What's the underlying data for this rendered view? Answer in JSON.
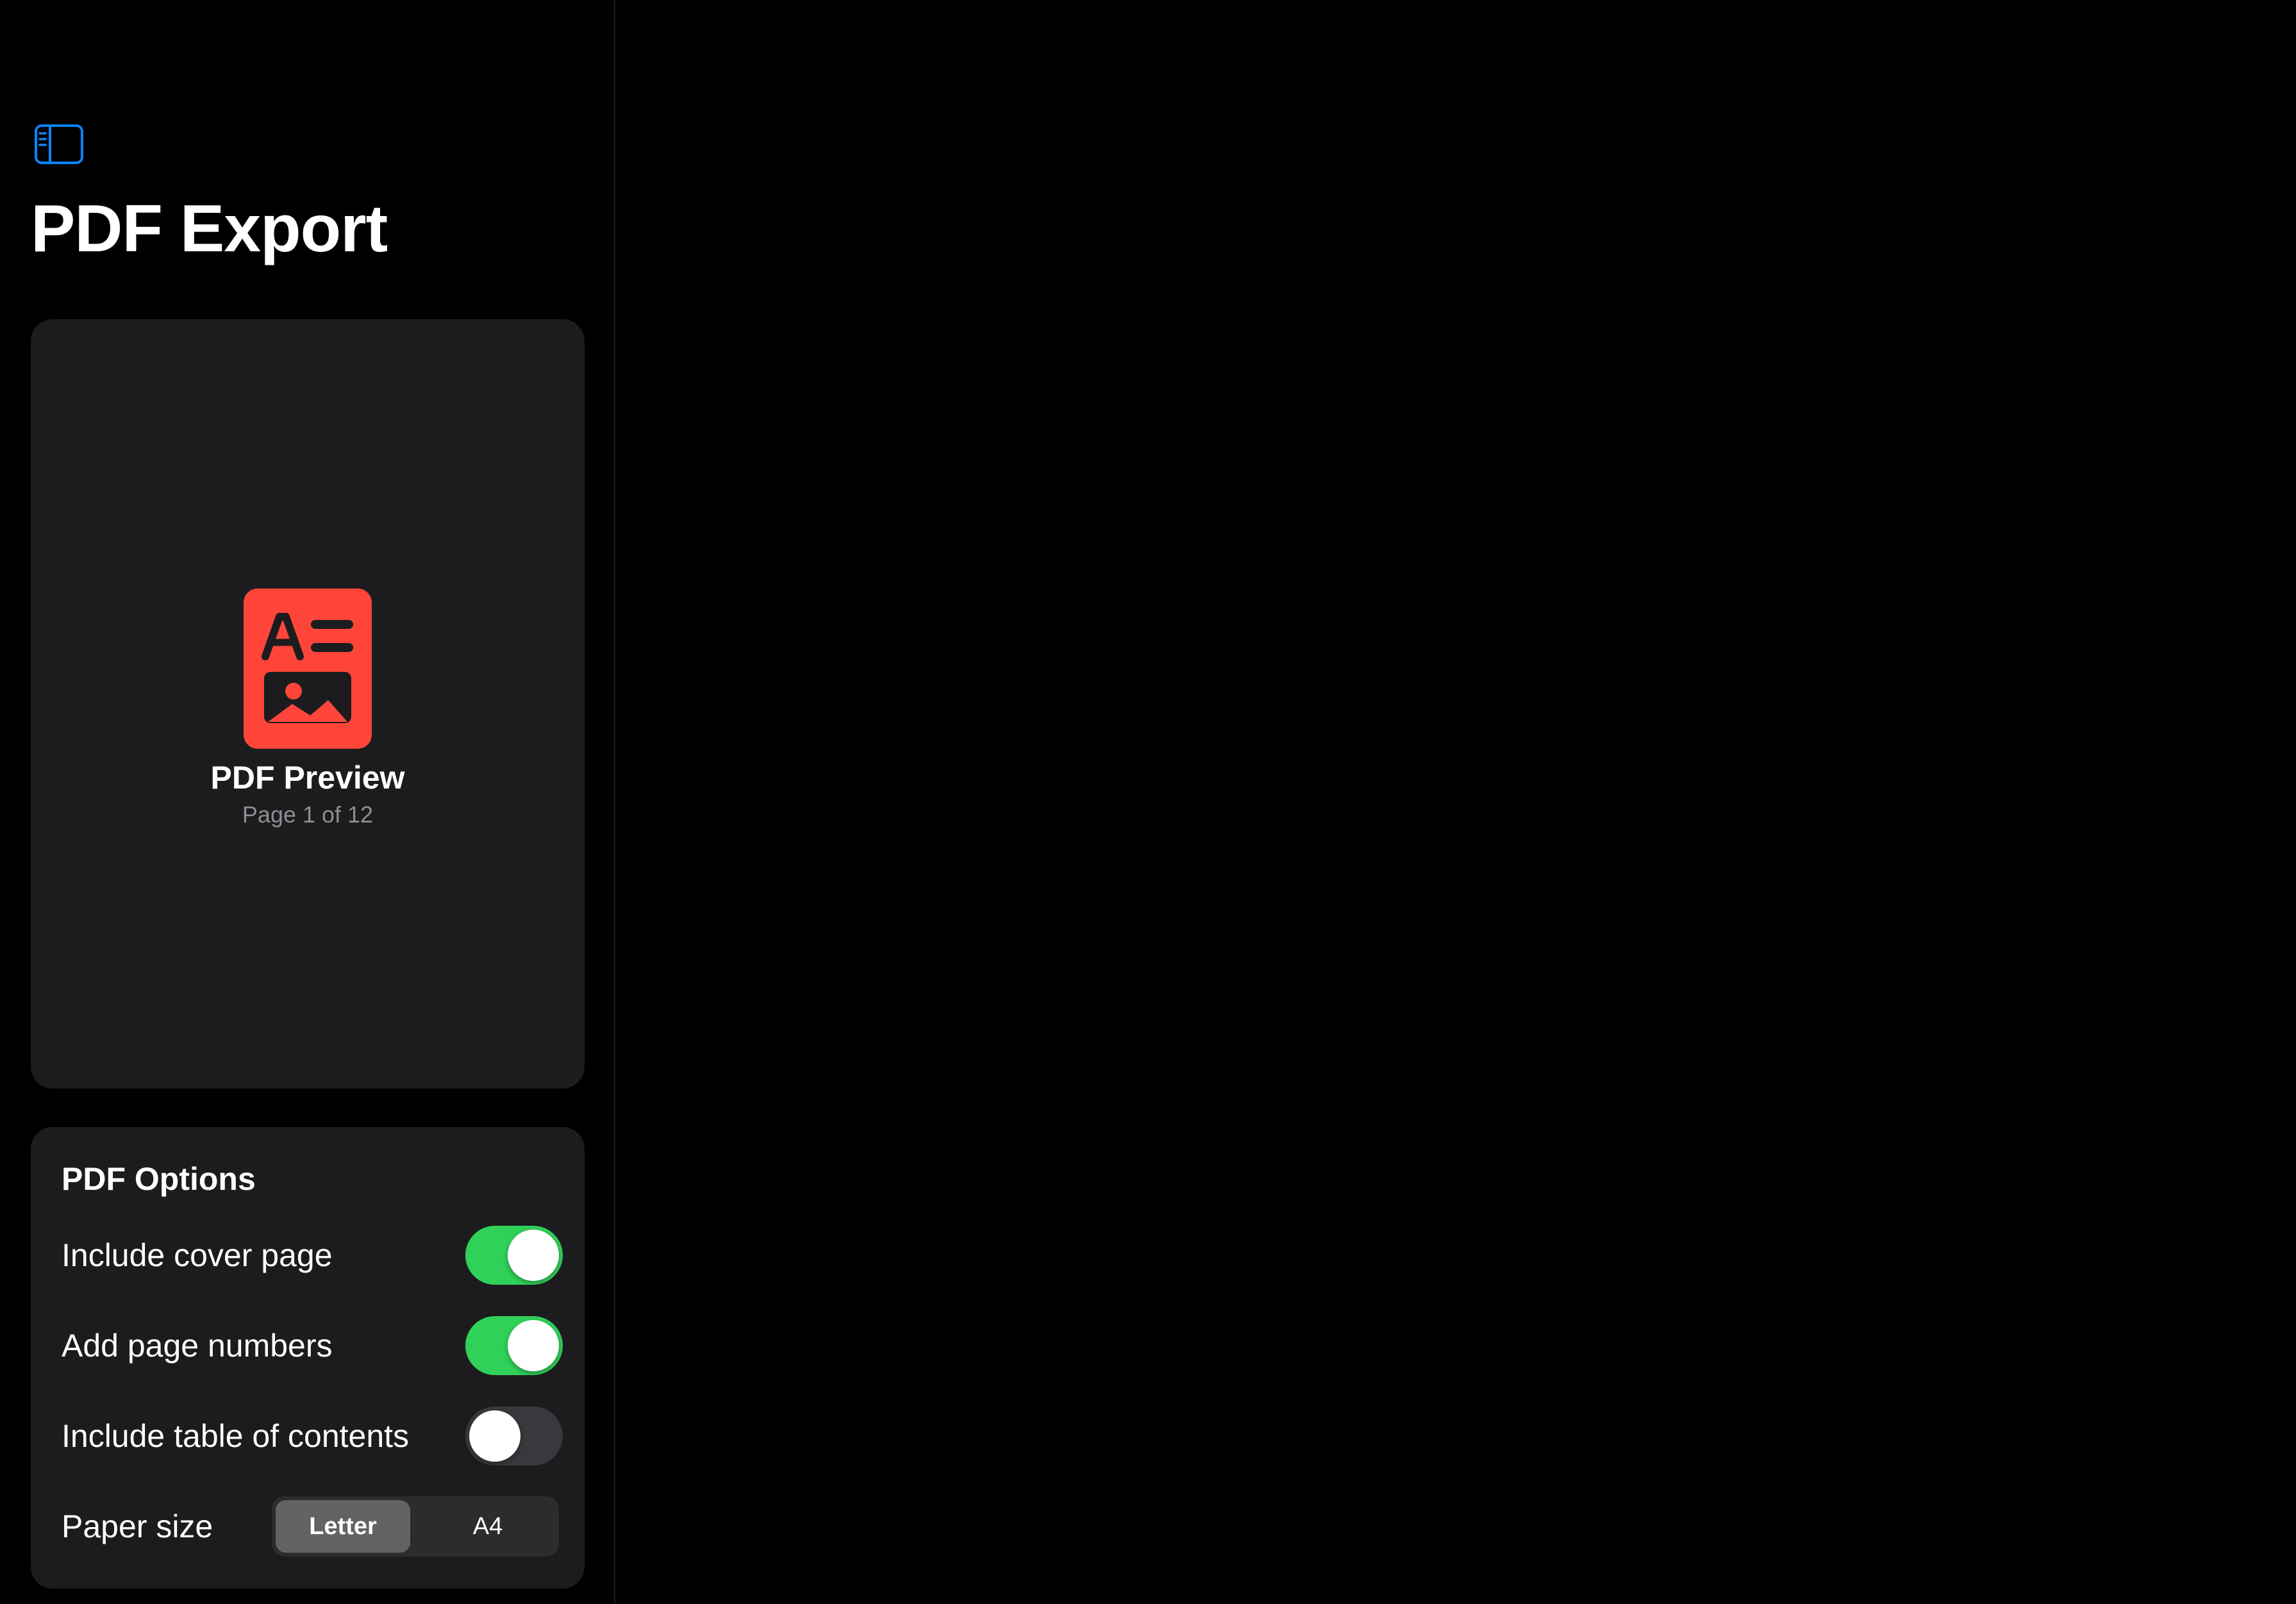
{
  "colors": {
    "background": "#000000",
    "card": "#1c1c1e",
    "accent": "#0a84ff",
    "doc_icon": "#ff453a",
    "toggle_on": "#30d158",
    "toggle_off": "#39393d",
    "secondary_text": "#8e8e93"
  },
  "sidebar": {
    "toggle_icon": "sidebar-left-icon",
    "title": "PDF Export"
  },
  "preview": {
    "icon": "doc-richtext-icon",
    "title": "PDF Preview",
    "subtitle": "Page 1 of 12"
  },
  "options": {
    "heading": "PDF Options",
    "rows": [
      {
        "label": "Include cover page",
        "on": true
      },
      {
        "label": "Add page numbers",
        "on": true
      },
      {
        "label": "Include table of contents",
        "on": false
      }
    ],
    "paper_size": {
      "label": "Paper size",
      "choices": [
        "Letter",
        "A4"
      ],
      "selected": "Letter"
    }
  }
}
